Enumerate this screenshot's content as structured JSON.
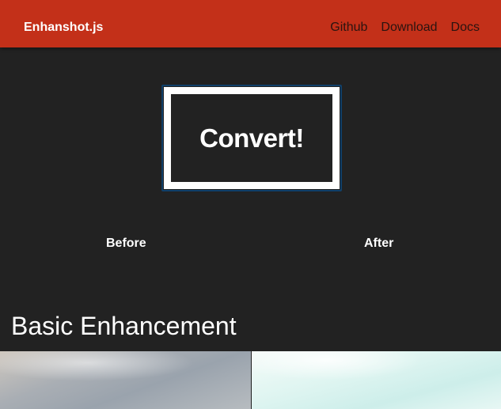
{
  "navbar": {
    "brand": "Enhanshot.js",
    "links": [
      "Github",
      "Download",
      "Docs"
    ],
    "background_color": "#c33019"
  },
  "hero": {
    "convert_label": "Convert!"
  },
  "comparison": {
    "before_label": "Before",
    "after_label": "After"
  },
  "section": {
    "title": "Basic Enhancement"
  },
  "colors": {
    "page_background": "#222222",
    "button_border": "#ffffff",
    "focus_ring": "#10406a"
  }
}
